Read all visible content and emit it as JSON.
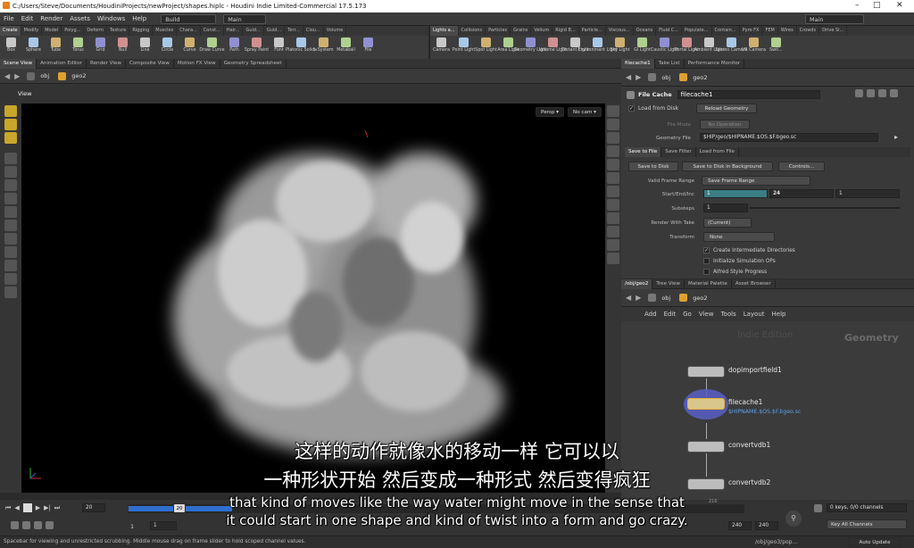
{
  "titlebar": {
    "title": "C:/Users/Steve/Documents/HoudiniProjects/newProject/shapes.hiplc - Houdini Indie Limited-Commercial 17.5.173",
    "min": "–",
    "max": "□",
    "close": "✕"
  },
  "menubar": {
    "items": [
      "File",
      "Edit",
      "Render",
      "Assets",
      "Windows",
      "Help"
    ],
    "desktop": "Build",
    "desktop2": "Main",
    "main_right": "Main"
  },
  "shelf_left": {
    "tabs": [
      "Create",
      "Modify",
      "Model",
      "Polyg...",
      "Deform",
      "Texture",
      "Rigging",
      "Muscles",
      "Chara...",
      "Const...",
      "Hair...",
      "Guid...",
      "Guid...",
      "Terr...",
      "Clou...",
      "Volume"
    ],
    "tools": [
      "Box",
      "Sphere",
      "Tube",
      "Torus",
      "Grid",
      "Null",
      "Line",
      "Circle",
      "Curve",
      "Draw Curve",
      "Path",
      "Spray Paint",
      "Font",
      "Platonic Solids",
      "L-System",
      "Metaball",
      "File"
    ]
  },
  "shelf_right": {
    "tabs": [
      "Lights a...",
      "Collisions",
      "Particles",
      "Grains",
      "Vellum",
      "Rigid B...",
      "Particle...",
      "Viscous...",
      "Oceans",
      "Fluid C...",
      "Populate...",
      "Contain...",
      "Pyro FX",
      "FEM",
      "Wires",
      "Crowds",
      "Drive Si..."
    ],
    "tools": [
      "Camera",
      "Point Light",
      "Spot Light",
      "Area Light",
      "Geometry Light",
      "Volume Light",
      "Distant Light",
      "Environment Light",
      "Sky Light",
      "GI Light",
      "Caustic Light",
      "Portal Light",
      "Ambient Light",
      "Stereo Camera",
      "VR Camera",
      "Swit..."
    ]
  },
  "left_pane_tabs": [
    "Scene View",
    "Animation Editor",
    "Render View",
    "Composite View",
    "Motion FX View",
    "Geometry Spreadsheet"
  ],
  "viewport": {
    "path1": "obj",
    "path2": "geo2",
    "label": "View",
    "persp": "Persp ▾",
    "cam": "No cam ▾"
  },
  "parm_tabs": [
    "filecache1",
    "Take List",
    "Performance Monitor"
  ],
  "parm": {
    "path1": "obj",
    "path2": "geo2",
    "type": "File Cache",
    "name": "filecache1",
    "load_from_disk": "Load from Disk",
    "reload": "Reload Geometry",
    "file_mode_label": "File Mode",
    "file_mode": "No Operation",
    "geo_file_label": "Geometry File",
    "geo_file": "$HIP/geo/$HIPNAME.$OS.$F.bgeo.sc",
    "subtabs": [
      "Save to File",
      "Save Filter",
      "Load from File"
    ],
    "save_to_disk": "Save to Disk",
    "save_bg": "Save to Disk in Background",
    "controls": "Controls...",
    "vfr_label": "Valid Frame Range",
    "vfr": "Save Frame Range",
    "sei_label": "Start/End/Inc",
    "start": "1",
    "end": "24",
    "inc": "1",
    "substeps_label": "Substeps",
    "substeps": "1",
    "rwt_label": "Render With Take",
    "rwt": "(Current)",
    "transform_label": "Transform",
    "transform": "None",
    "opt1": "Create Intermediate Directories",
    "opt2": "Initialize Simulation OPs",
    "opt3": "Alfred Style Progress"
  },
  "net_tabs": [
    "/obj/geo2",
    "Tree View",
    "Material Palette",
    "Asset Browser"
  ],
  "network": {
    "path1": "obj",
    "path2": "geo2",
    "menu": [
      "Add",
      "Edit",
      "Go",
      "View",
      "Tools",
      "Layout",
      "Help"
    ],
    "watermark": "Indie Edition",
    "context": "Geometry",
    "nodes": [
      {
        "name": "dopimportfield1"
      },
      {
        "name": "filecache1",
        "sub": "$HIPNAME.$OS.$F.bgeo.sc"
      },
      {
        "name": "convertvdb1"
      },
      {
        "name": "convertvdb2"
      }
    ]
  },
  "timeline": {
    "frame": "20",
    "frame_marker": "20",
    "tick_216": "216",
    "start": "1",
    "start2": "1",
    "end": "240",
    "end2": "240",
    "keys": "0 keys, 0/0 channels",
    "key_all": "Key All Channels"
  },
  "status": {
    "text": "Spacebar for viewing and unrestricted scrubbing. Middle mouse drag on frame slider to hold scoped channel values.",
    "path": "/obj/geo3/pop...",
    "update": "Auto Update"
  },
  "subtitles": {
    "zh1": "这样的动作就像水的移动一样 它可以以",
    "zh2": "一种形状开始 然后变成一种形式 然后变得疯狂",
    "en1": "that kind of moves like the way water might move in the sense that",
    "en2": "it could start in one shape and kind of twist into a form and go crazy."
  },
  "colors": {
    "accent": "#4a90d9",
    "timeline_blue": "#2e6fd0",
    "start_teal": "#3a7d83"
  }
}
